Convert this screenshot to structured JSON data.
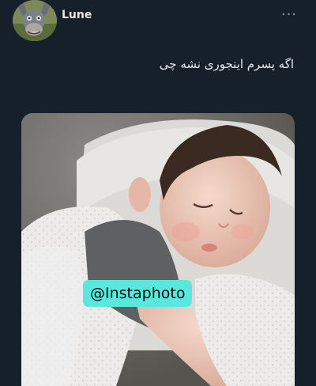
{
  "tweet": {
    "author": "Lune",
    "text": "اگه پسرم اینجوری نشه چی",
    "more_icon": "more-horizontal-icon"
  },
  "media": {
    "watermark": "@Instaphoto"
  },
  "colors": {
    "background": "#15202b",
    "text": "#e7e9ea",
    "muted": "#8b98a5",
    "watermark_bg": "#58e8dd"
  }
}
